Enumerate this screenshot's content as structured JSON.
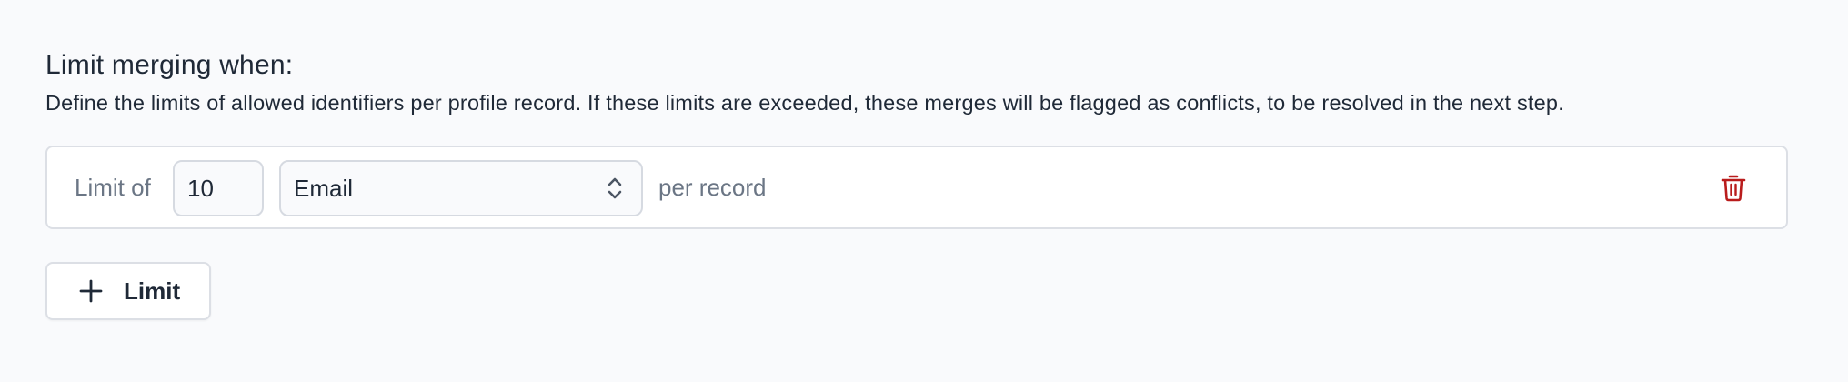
{
  "section": {
    "title": "Limit merging when:",
    "description": "Define the limits of allowed identifiers per profile record. If these limits are exceeded, these merges will be flagged as conflicts, to be resolved in the next step."
  },
  "limit_rows": [
    {
      "prefix_label": "Limit of",
      "count_value": "10",
      "identifier_selected": "Email",
      "suffix_label": "per record",
      "delete_icon": "trash-icon"
    }
  ],
  "add_button": {
    "label": "Limit",
    "icon": "plus-icon"
  },
  "colors": {
    "background": "#f9fafc",
    "text": "#1f2937",
    "muted_text": "#6b7685",
    "border": "#dcdfe5",
    "danger": "#b91c1c"
  }
}
